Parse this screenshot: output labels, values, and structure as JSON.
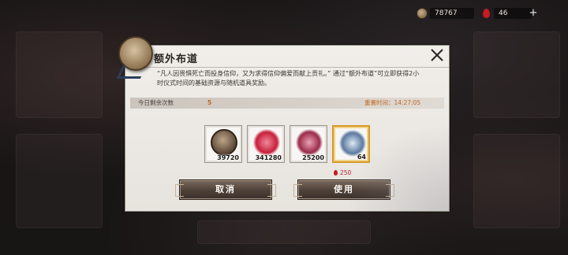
{
  "resources": {
    "coins": "78767",
    "blood": "46",
    "add_label": "+"
  },
  "dialog": {
    "title": "额外布道",
    "description": "“凡人因畏惧死亡而投身信仰，又为求得信仰偏爱而献上贡礼。” 通过“额外布道”可立即获得2小时仪式时间的基础资源与随机道具奖励。",
    "remaining_label": "今日剩余次数",
    "remaining_count": "5",
    "reset_time": "重置时间：14:27:05",
    "items": [
      {
        "icon": "coin-icon",
        "qty": "39720",
        "selected": false
      },
      {
        "icon": "red-flower-icon",
        "qty": "341280",
        "selected": false
      },
      {
        "icon": "pink-bird-icon",
        "qty": "25200",
        "selected": false
      },
      {
        "icon": "blue-fish-icon",
        "qty": "64",
        "selected": true
      }
    ],
    "cost": "250",
    "cancel_label": "取消",
    "use_label": "使用"
  },
  "colors": {
    "accent_orange": "#c0651f",
    "cost_red": "#b52a2a",
    "selected_border": "#d79a2a"
  }
}
